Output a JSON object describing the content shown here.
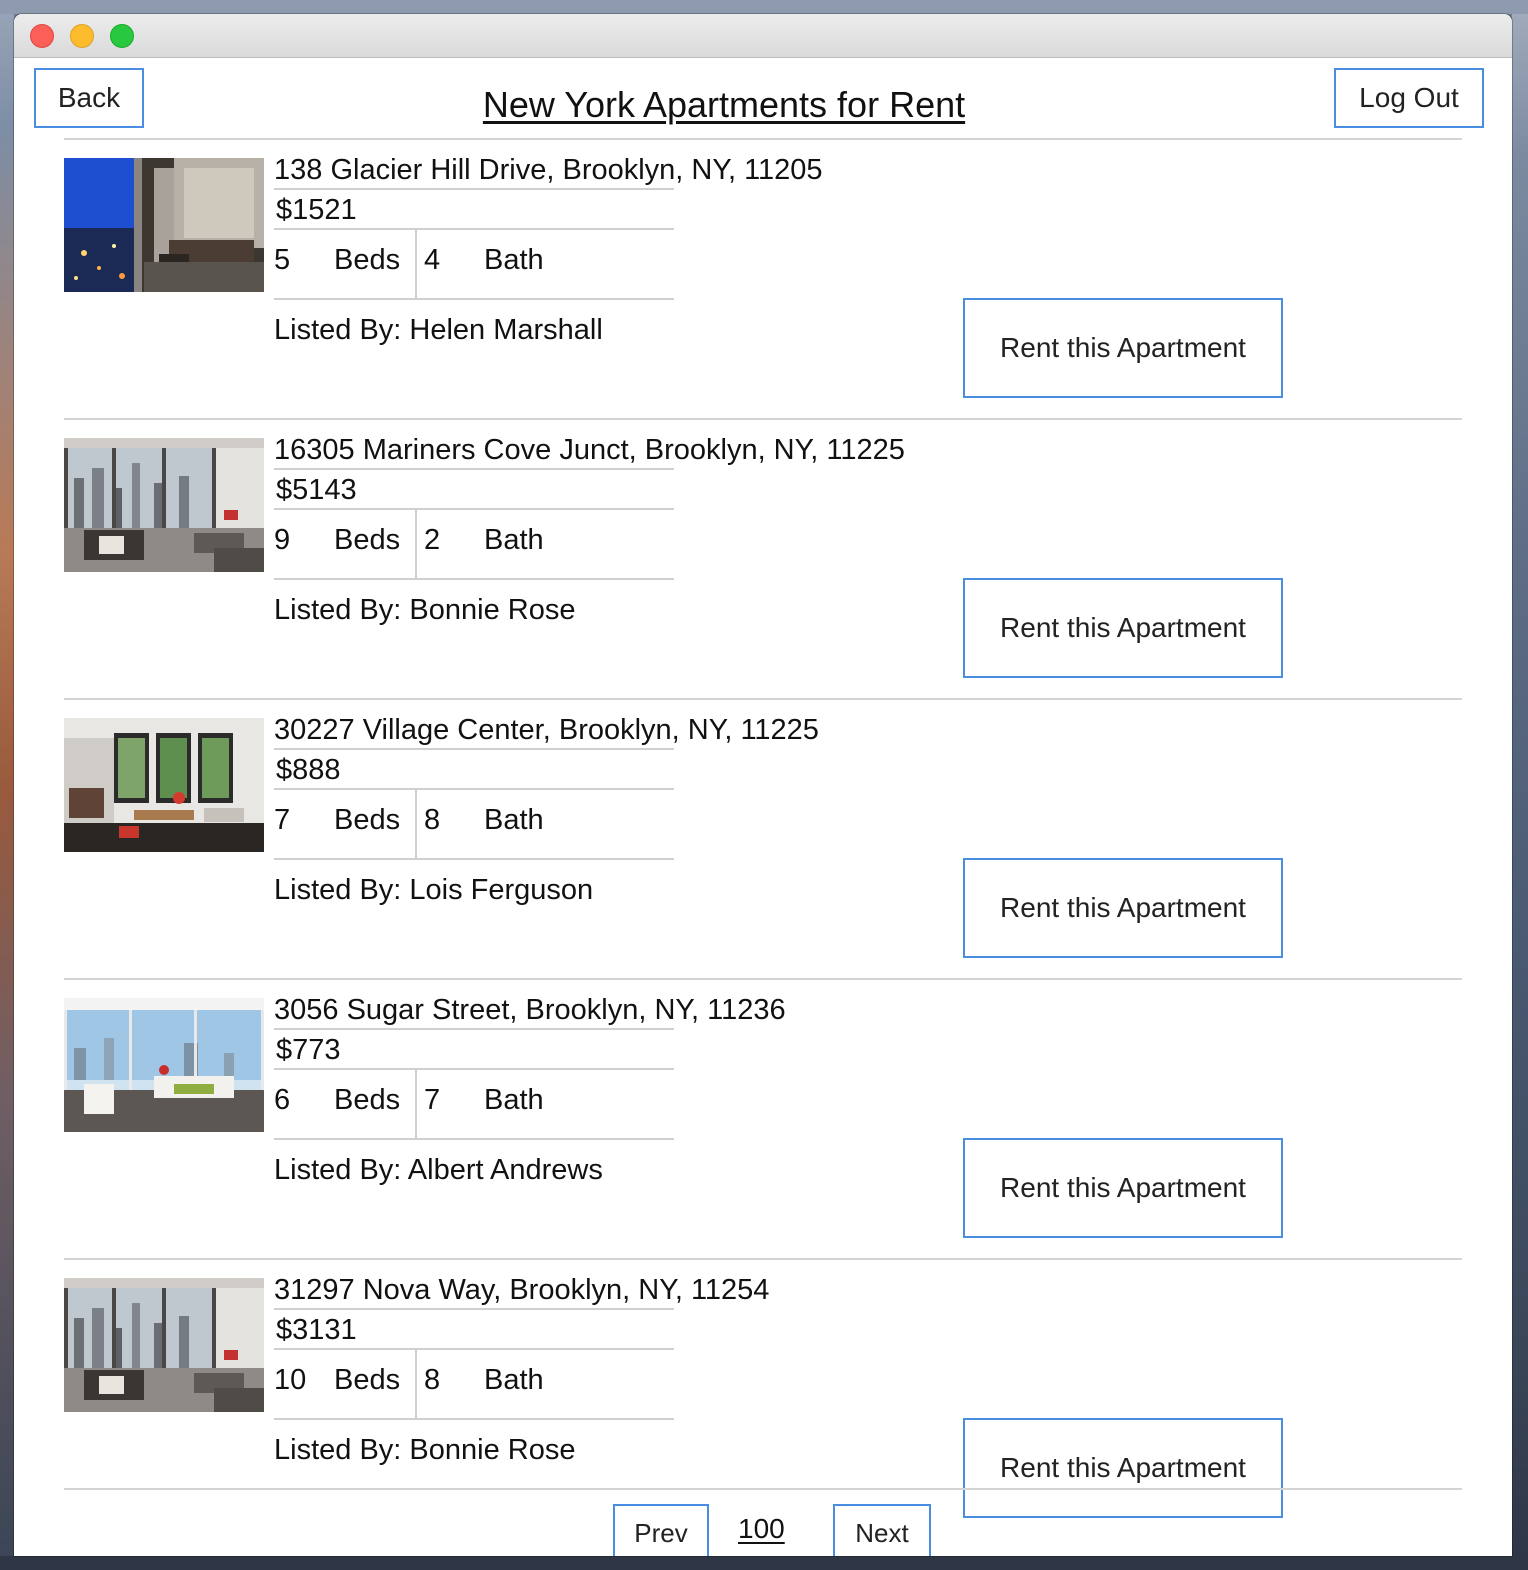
{
  "window": {
    "controls": [
      "close",
      "minimize",
      "zoom"
    ]
  },
  "header": {
    "back_label": "Back",
    "title": "New York Apartments for Rent",
    "logout_label": "Log Out"
  },
  "listings": [
    {
      "address": "138 Glacier Hill Drive, Brooklyn, NY, 11205",
      "price": "$1521",
      "beds": "5",
      "beds_label": "Beds",
      "baths": "4",
      "baths_label": "Bath",
      "listed_by": "Listed By: Helen Marshall",
      "rent_label": "Rent this Apartment",
      "photo": "bedroom-city-view"
    },
    {
      "address": "16305 Mariners Cove Junct, Brooklyn, NY, 11225",
      "price": "$5143",
      "beds": "9",
      "beds_label": "Beds",
      "baths": "2",
      "baths_label": "Bath",
      "listed_by": "Listed By: Bonnie Rose",
      "rent_label": "Rent this Apartment",
      "photo": "living-room-skyline"
    },
    {
      "address": "30227 Village Center, Brooklyn, NY, 11225",
      "price": "$888",
      "beds": "7",
      "beds_label": "Beds",
      "baths": "8",
      "baths_label": "Bath",
      "listed_by": "Listed By: Lois Ferguson",
      "rent_label": "Rent this Apartment",
      "photo": "brick-loft-living-room"
    },
    {
      "address": "3056 Sugar Street, Brooklyn, NY, 11236",
      "price": "$773",
      "beds": "6",
      "beds_label": "Beds",
      "baths": "7",
      "baths_label": "Bath",
      "listed_by": "Listed By: Albert Andrews",
      "rent_label": "Rent this Apartment",
      "photo": "glass-penthouse-lounge"
    },
    {
      "address": "31297 Nova Way, Brooklyn, NY, 11254",
      "price": "$3131",
      "beds": "10",
      "beds_label": "Beds",
      "baths": "8",
      "baths_label": "Bath",
      "listed_by": "Listed By: Bonnie Rose",
      "rent_label": "Rent this Apartment",
      "photo": "living-room-skyline"
    }
  ],
  "pagination": {
    "prev_label": "Prev",
    "page": "100",
    "next_label": "Next"
  }
}
